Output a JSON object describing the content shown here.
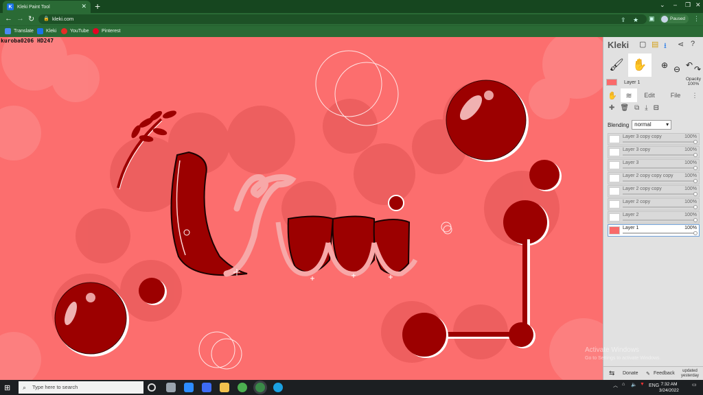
{
  "browser": {
    "tab_title": "Kleki Paint Tool",
    "tab_favicon": "K",
    "url": "kleki.com",
    "profile_status": "Paused",
    "bookmarks": [
      "Translate",
      "Kleki",
      "YouTube",
      "Pinterest"
    ]
  },
  "canvas": {
    "tag_text": "kuroba0206  HD247"
  },
  "panel": {
    "app_name": "Kleki",
    "current_layer": "Layer 1",
    "opacity_label": "Opacity",
    "opacity_value": "100%",
    "tabs": [
      "Edit",
      "File"
    ],
    "blending_label": "Blending",
    "blending_value": "normal",
    "layers": [
      {
        "name": "Layer 3 copy copy",
        "opacity": "100%"
      },
      {
        "name": "Layer 3 copy",
        "opacity": "100%"
      },
      {
        "name": "Layer 3",
        "opacity": "100%"
      },
      {
        "name": "Layer 2 copy copy copy",
        "opacity": "100%"
      },
      {
        "name": "Layer 2 copy copy",
        "opacity": "100%"
      },
      {
        "name": "Layer 2 copy",
        "opacity": "100%"
      },
      {
        "name": "Layer 2",
        "opacity": "100%"
      },
      {
        "name": "Layer 1",
        "opacity": "100%"
      }
    ],
    "footer": {
      "donate": "Donate",
      "feedback": "Feedback",
      "updated_line1": "updated",
      "updated_line2": "yesterday"
    }
  },
  "watermark": {
    "line1": "Activate Windows",
    "line2": "Go to Settings to activate Windows."
  },
  "taskbar": {
    "search_placeholder": "Type here to search",
    "language": "ENG",
    "time": "7:32 AM",
    "date": "3/24/2022"
  },
  "colors": {
    "canvas_bg": "#fc6e6e",
    "dark_red": "#9c0000",
    "chrome_green": "#2a6a35"
  }
}
